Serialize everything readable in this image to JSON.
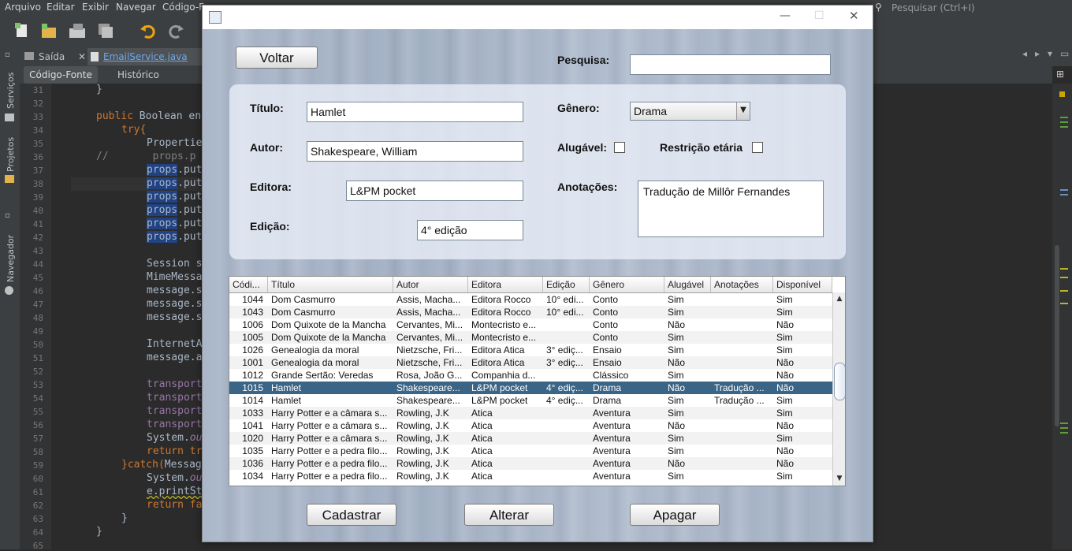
{
  "ide": {
    "menu": [
      "Arquivo",
      "Editar",
      "Exibir",
      "Navegar",
      "Código-F"
    ],
    "search_placeholder": "Pesquisar (Ctrl+I)",
    "file_tabs": [
      "Saída",
      "EmailService.java"
    ],
    "editor_tabs": [
      "Código-Fonte",
      "Histórico"
    ],
    "side_panels": [
      "Serviços",
      "Projetos",
      "Navegador"
    ],
    "line_numbers": [
      "31",
      "32",
      "33",
      "34",
      "35",
      "36",
      "37",
      "38",
      "39",
      "40",
      "41",
      "42",
      "43",
      "44",
      "45",
      "46",
      "47",
      "48",
      "49",
      "50",
      "51",
      "52",
      "53",
      "54",
      "55",
      "56",
      "57",
      "58",
      "59",
      "60",
      "61",
      "62",
      "63",
      "64",
      "65"
    ],
    "code": {
      "l31": "}",
      "l33a": "public",
      "l33b": " Boolean en",
      "l34": "try{",
      "l35": "Propertie",
      "l36a": "//",
      "l36b": "props.p",
      "props": "props",
      "dot_put": ".put",
      "l44": "Session s",
      "l45": "MimeMessa",
      "l46": "message.s",
      "l50": "InternetA",
      "l51": "message.a",
      "transport": "transport",
      "system": "System.",
      "out": "out",
      "return_kw": "return",
      "l58b": " tr",
      "l59a": "}catch(",
      "l59b": "Messag",
      "l61": "e.printSt",
      "l62b": " fa",
      "l63": "}",
      "l64": "}"
    }
  },
  "dialog": {
    "buttons": {
      "voltar": "Voltar",
      "cadastrar": "Cadastrar",
      "alterar": "Alterar",
      "apagar": "Apagar"
    },
    "search_label": "Pesquisa:",
    "search_value": "",
    "fields": {
      "titulo_label": "Título:",
      "titulo_value": "Hamlet",
      "autor_label": "Autor:",
      "autor_value": "Shakespeare, William",
      "editora_label": "Editora:",
      "editora_value": "L&PM pocket",
      "edicao_label": "Edição:",
      "edicao_value": "4° edição",
      "genero_label": "Gênero:",
      "genero_value": "Drama",
      "alugavel_label": "Alugável:",
      "restricao_label": "Restrição etária",
      "anotacoes_label": "Anotações:",
      "anotacoes_value": "Tradução de Millôr Fernandes"
    },
    "table": {
      "headers": [
        "Códi...",
        "Título",
        "Autor",
        "Editora",
        "Edição",
        "Gênero",
        "Alugável",
        "Anotações",
        "Disponível"
      ],
      "rows": [
        [
          "1044",
          "Dom Casmurro",
          "Assis, Macha...",
          "Editora Rocco",
          "10° edi...",
          "Conto",
          "Sim",
          "",
          "Sim"
        ],
        [
          "1043",
          "Dom Casmurro",
          "Assis, Macha...",
          "Editora Rocco",
          "10° edi...",
          "Conto",
          "Sim",
          "",
          "Sim"
        ],
        [
          "1006",
          "Dom Quixote de la Mancha",
          "Cervantes, Mi...",
          "Montecristo e...",
          "",
          "Conto",
          "Não",
          "",
          "Não"
        ],
        [
          "1005",
          "Dom Quixote de la Mancha",
          "Cervantes, Mi...",
          "Montecristo e...",
          "",
          "Conto",
          "Sim",
          "",
          "Sim"
        ],
        [
          "1026",
          "Genealogia da moral",
          "Nietzsche, Fri...",
          "Editora Atica",
          "3° ediç...",
          "Ensaio",
          "Sim",
          "",
          "Sim"
        ],
        [
          "1001",
          "Genealogia da moral",
          "Nietzsche, Fri...",
          "Editora Atica",
          "3° ediç...",
          "Ensaio",
          "Não",
          "",
          "Não"
        ],
        [
          "1012",
          "Grande Sertão: Veredas",
          "Rosa, João G...",
          "Companhia d...",
          "",
          "Clássico",
          "Sim",
          "",
          "Não"
        ],
        [
          "1015",
          "Hamlet",
          "Shakespeare...",
          "L&PM pocket",
          "4° ediç...",
          "Drama",
          "Não",
          "Tradução ...",
          "Não"
        ],
        [
          "1014",
          "Hamlet",
          "Shakespeare...",
          "L&PM pocket",
          "4° ediç...",
          "Drama",
          "Sim",
          "Tradução ...",
          "Sim"
        ],
        [
          "1033",
          "Harry Potter e a câmara s...",
          "Rowling, J.K",
          "Atica",
          "",
          "Aventura",
          "Sim",
          "",
          "Sim"
        ],
        [
          "1041",
          "Harry Potter e a câmara s...",
          "Rowling, J.K",
          "Atica",
          "",
          "Aventura",
          "Não",
          "",
          "Não"
        ],
        [
          "1020",
          "Harry Potter e a câmara s...",
          "Rowling, J.K",
          "Atica",
          "",
          "Aventura",
          "Sim",
          "",
          "Sim"
        ],
        [
          "1035",
          "Harry Potter e a pedra filo...",
          "Rowling, J.K",
          "Atica",
          "",
          "Aventura",
          "Sim",
          "",
          "Não"
        ],
        [
          "1036",
          "Harry Potter e a pedra filo...",
          "Rowling, J.K",
          "Atica",
          "",
          "Aventura",
          "Não",
          "",
          "Não"
        ],
        [
          "1034",
          "Harry Potter e a pedra filo...",
          "Rowling, J.K",
          "Atica",
          "",
          "Aventura",
          "Sim",
          "",
          "Sim"
        ]
      ],
      "selected_row": 7
    }
  },
  "colors": {
    "selection": "#3a6587",
    "code_highlight": "#214283",
    "keyword": "#cc7832"
  }
}
